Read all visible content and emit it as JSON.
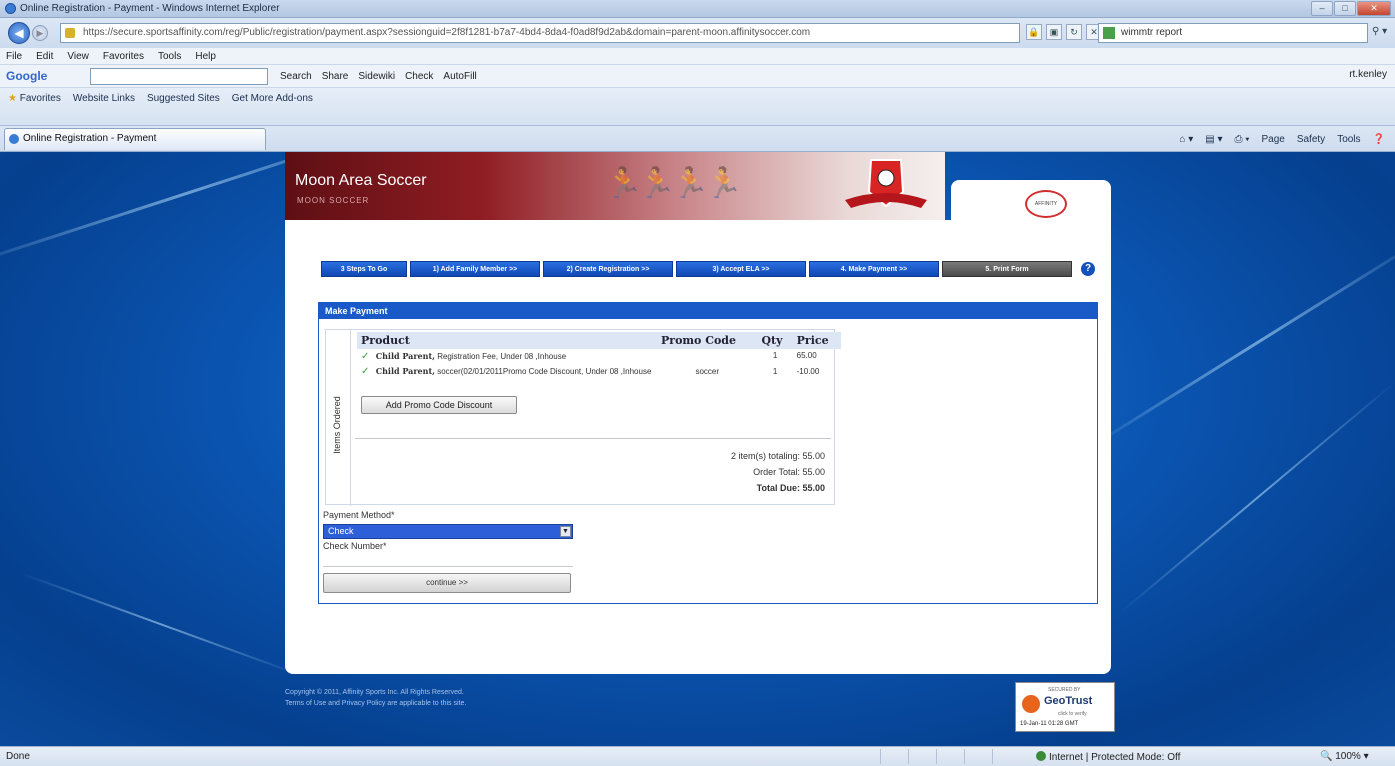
{
  "window": {
    "title": "Online Registration - Payment - Windows Internet Explorer",
    "url": "https://secure.sportsaffinity.com/reg/Public/registration/payment.aspx?sessionguid=2f8f1281-b7a7-4bd4-8da4-f0ad8f9d2ab&domain=parent-moon.affinitysoccer.com",
    "search_value": "wimmtr report"
  },
  "menu": [
    "File",
    "Edit",
    "View",
    "Favorites",
    "Tools",
    "Help"
  ],
  "googlebar": {
    "logo": "Google",
    "buttons": [
      "Search",
      "Share",
      "Sidewiki",
      "Check",
      "AutoFill"
    ],
    "user": "rt.kenley"
  },
  "favorites": {
    "label": "Favorites",
    "items": [
      "Website Links",
      "Suggested Sites",
      "Get More Add-ons"
    ]
  },
  "tab": {
    "label": "Online Registration - Payment"
  },
  "command_bar": [
    "Page",
    "Safety",
    "Tools"
  ],
  "site": {
    "title": "Moon Area Soccer",
    "subtitle": "MOON SOCCER"
  },
  "steps": [
    {
      "label": "3 Steps To Go"
    },
    {
      "label": "1) Add Family Member >>"
    },
    {
      "label": "2) Create Registration >>"
    },
    {
      "label": "3) Accept ELA >>"
    },
    {
      "label": "4. Make Payment >>"
    },
    {
      "label": "5. Print Form"
    }
  ],
  "panel": {
    "header": "Make Payment",
    "side_label": "Items Ordered",
    "columns": [
      "Product",
      "Promo Code",
      "Qty",
      "Price"
    ],
    "rows": [
      {
        "name": "Child Parent,",
        "desc": "Registration Fee, Under 08 ,Inhouse",
        "promo": "",
        "qty": "1",
        "price": "65.00"
      },
      {
        "name": "Child Parent,",
        "desc": "soccer(02/01/2011Promo Code Discount, Under 08 ,Inhouse",
        "promo": "soccer",
        "qty": "1",
        "price": "-10.00"
      }
    ],
    "promo_button": "Add Promo Code Discount",
    "totals": {
      "items_totaling": "2 item(s) totaling: 55.00",
      "order_total": "Order Total: 55.00",
      "total_due": "Total Due: 55.00"
    },
    "payment_method_label": "Payment Method*",
    "payment_method_value": "Check",
    "check_number_label": "Check Number*",
    "continue_button": "continue >>"
  },
  "footer": {
    "line1": "Copyright © 2011, Affinity Sports Inc. All Rights Reserved.",
    "line2": "Terms of Use and Privacy Policy are applicable to this site."
  },
  "geotrust": {
    "secured_by": "SECURED BY",
    "name": "GeoTrust",
    "click": "click to verify",
    "date": "19-Jan-11 01:28 GMT"
  },
  "status": {
    "left": "Done",
    "zone": "Internet | Protected Mode: Off",
    "zoom": "100%"
  },
  "colors": {
    "step_blue": "#1a59c8",
    "step_dark": "#555555",
    "banner_red": "#8f1d23"
  }
}
